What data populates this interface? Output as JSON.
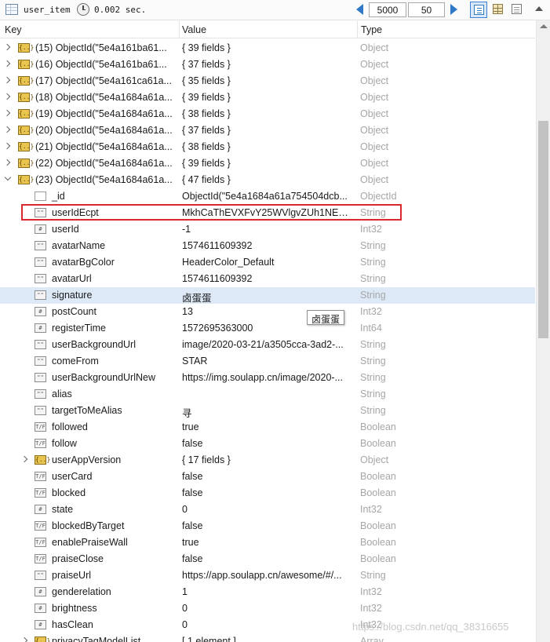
{
  "toolbar": {
    "collection": "user_item",
    "elapsed": "0.002 sec.",
    "skip": "5000",
    "limit": "50"
  },
  "columns": {
    "key": "Key",
    "value": "Value",
    "type": "Type"
  },
  "rows": [
    {
      "k": "(15) ObjectId(\"5e4a161ba61...",
      "v": "{ 39 fields }",
      "t": "Object",
      "icon": "obj",
      "exp": "closed",
      "level": 0
    },
    {
      "k": "(16) ObjectId(\"5e4a161ba61...",
      "v": "{ 37 fields }",
      "t": "Object",
      "icon": "obj",
      "exp": "closed",
      "level": 0
    },
    {
      "k": "(17) ObjectId(\"5e4a161ca61a...",
      "v": "{ 35 fields }",
      "t": "Object",
      "icon": "obj",
      "exp": "closed",
      "level": 0
    },
    {
      "k": "(18) ObjectId(\"5e4a1684a61a...",
      "v": "{ 39 fields }",
      "t": "Object",
      "icon": "obj",
      "exp": "closed",
      "level": 0
    },
    {
      "k": "(19) ObjectId(\"5e4a1684a61a...",
      "v": "{ 38 fields }",
      "t": "Object",
      "icon": "obj",
      "exp": "closed",
      "level": 0
    },
    {
      "k": "(20) ObjectId(\"5e4a1684a61a...",
      "v": "{ 37 fields }",
      "t": "Object",
      "icon": "obj",
      "exp": "closed",
      "level": 0
    },
    {
      "k": "(21) ObjectId(\"5e4a1684a61a...",
      "v": "{ 38 fields }",
      "t": "Object",
      "icon": "obj",
      "exp": "closed",
      "level": 0
    },
    {
      "k": "(22) ObjectId(\"5e4a1684a61a...",
      "v": "{ 39 fields }",
      "t": "Object",
      "icon": "obj",
      "exp": "closed",
      "level": 0
    },
    {
      "k": "(23) ObjectId(\"5e4a1684a61a...",
      "v": "{ 47 fields }",
      "t": "Object",
      "icon": "obj",
      "exp": "open",
      "level": 0
    },
    {
      "k": "_id",
      "v": "ObjectId(\"5e4a1684a61a754504dcb...",
      "t": "ObjectId",
      "icon": "empty",
      "level": 1
    },
    {
      "k": "userIdEcpt",
      "v": "MkhCaThEVXFvY25WVlgvZUh1NEEx...",
      "t": "String",
      "icon": "\"\"",
      "level": 1
    },
    {
      "k": "userId",
      "v": "-1",
      "t": "Int32",
      "icon": "#",
      "level": 1
    },
    {
      "k": "avatarName",
      "v": "1574611609392",
      "t": "String",
      "icon": "\"\"",
      "level": 1
    },
    {
      "k": "avatarBgColor",
      "v": "HeaderColor_Default",
      "t": "String",
      "icon": "\"\"",
      "level": 1
    },
    {
      "k": "avatarUrl",
      "v": "1574611609392",
      "t": "String",
      "icon": "\"\"",
      "level": 1
    },
    {
      "k": "signature",
      "v": "卤蛋蛋",
      "t": "String",
      "icon": "\"\"",
      "level": 1,
      "hl": true
    },
    {
      "k": "postCount",
      "v": "13",
      "t": "Int32",
      "icon": "#",
      "level": 1
    },
    {
      "k": "registerTime",
      "v": "1572695363000",
      "t": "Int64",
      "icon": "#",
      "level": 1
    },
    {
      "k": "userBackgroundUrl",
      "v": "image/2020-03-21/a3505cca-3ad2-...",
      "t": "String",
      "icon": "\"\"",
      "level": 1
    },
    {
      "k": "comeFrom",
      "v": "STAR",
      "t": "String",
      "icon": "\"\"",
      "level": 1
    },
    {
      "k": "userBackgroundUrlNew",
      "v": "https://img.soulapp.cn/image/2020-...",
      "t": "String",
      "icon": "\"\"",
      "level": 1
    },
    {
      "k": "alias",
      "v": "",
      "t": "String",
      "icon": "\"\"",
      "level": 1
    },
    {
      "k": "targetToMeAlias",
      "v": "寻",
      "t": "String",
      "icon": "\"\"",
      "level": 1
    },
    {
      "k": "followed",
      "v": "true",
      "t": "Boolean",
      "icon": "T/F",
      "level": 1
    },
    {
      "k": "follow",
      "v": "false",
      "t": "Boolean",
      "icon": "T/F",
      "level": 1
    },
    {
      "k": "userAppVersion",
      "v": "{ 17 fields }",
      "t": "Object",
      "icon": "obj",
      "exp": "closed",
      "level": 1
    },
    {
      "k": "userCard",
      "v": "false",
      "t": "Boolean",
      "icon": "T/F",
      "level": 1
    },
    {
      "k": "blocked",
      "v": "false",
      "t": "Boolean",
      "icon": "T/F",
      "level": 1
    },
    {
      "k": "state",
      "v": "0",
      "t": "Int32",
      "icon": "#",
      "level": 1
    },
    {
      "k": "blockedByTarget",
      "v": "false",
      "t": "Boolean",
      "icon": "T/F",
      "level": 1
    },
    {
      "k": "enablePraiseWall",
      "v": "true",
      "t": "Boolean",
      "icon": "T/F",
      "level": 1
    },
    {
      "k": "praiseClose",
      "v": "false",
      "t": "Boolean",
      "icon": "T/F",
      "level": 1
    },
    {
      "k": "praiseUrl",
      "v": "https://app.soulapp.cn/awesome/#/...",
      "t": "String",
      "icon": "\"\"",
      "level": 1
    },
    {
      "k": "genderelation",
      "v": "1",
      "t": "Int32",
      "icon": "#",
      "level": 1
    },
    {
      "k": "brightness",
      "v": "0",
      "t": "Int32",
      "icon": "#",
      "level": 1
    },
    {
      "k": "hasClean",
      "v": "0",
      "t": "Int32",
      "icon": "#",
      "level": 1
    },
    {
      "k": "privacyTagModelList",
      "v": "[ 1 element ]",
      "t": "Array",
      "icon": "obj",
      "exp": "closed",
      "level": 1
    }
  ],
  "tooltip": "卤蛋蛋",
  "watermark": "https://blog.csdn.net/qq_38316655",
  "colors": {
    "highlight_row": "#dde9f7",
    "red_box": "#d9282e",
    "type_text": "#a6a6a6",
    "accent": "#2f78c8"
  }
}
